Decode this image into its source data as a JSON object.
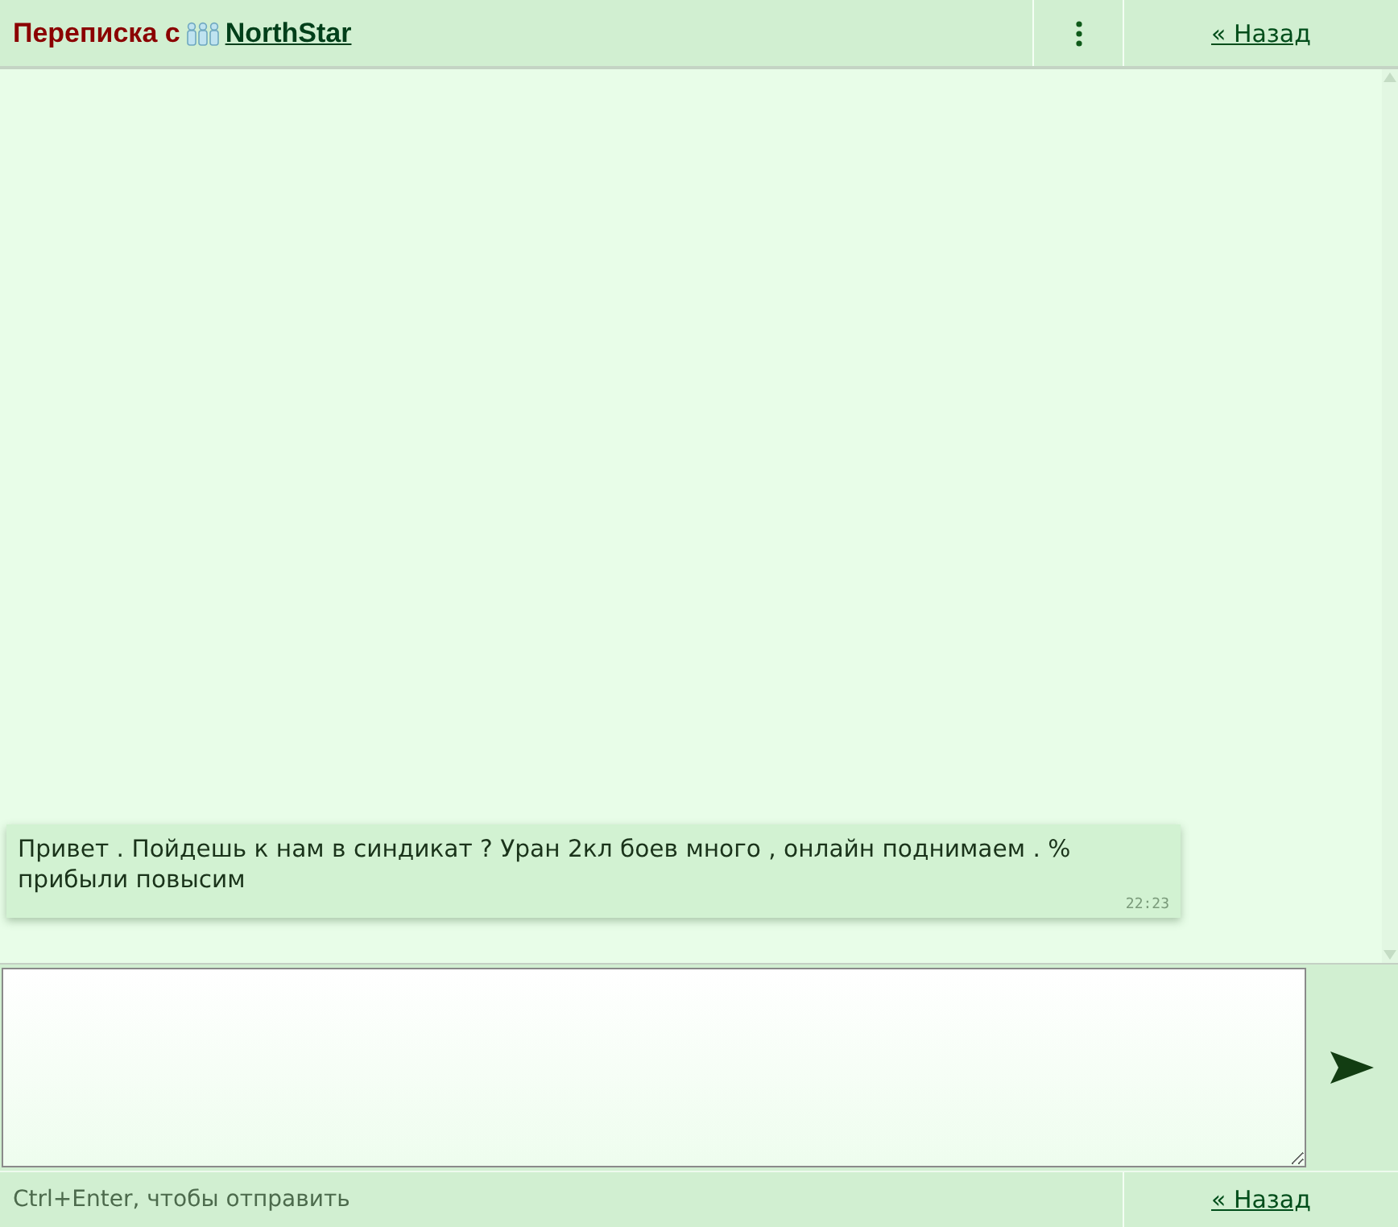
{
  "header": {
    "title": "Переписка с",
    "contact": {
      "name": "NorthStar"
    },
    "back_link": "« Назад"
  },
  "messages": [
    {
      "text": "Привет . Пойдешь к нам в синдикат ? Уран 2кл боев много , онлайн поднимаем . % прибыли повысим",
      "time": "22:23"
    }
  ],
  "footer": {
    "hint": "Ctrl+Enter, чтобы отправить",
    "back_link": "« Назад"
  }
}
